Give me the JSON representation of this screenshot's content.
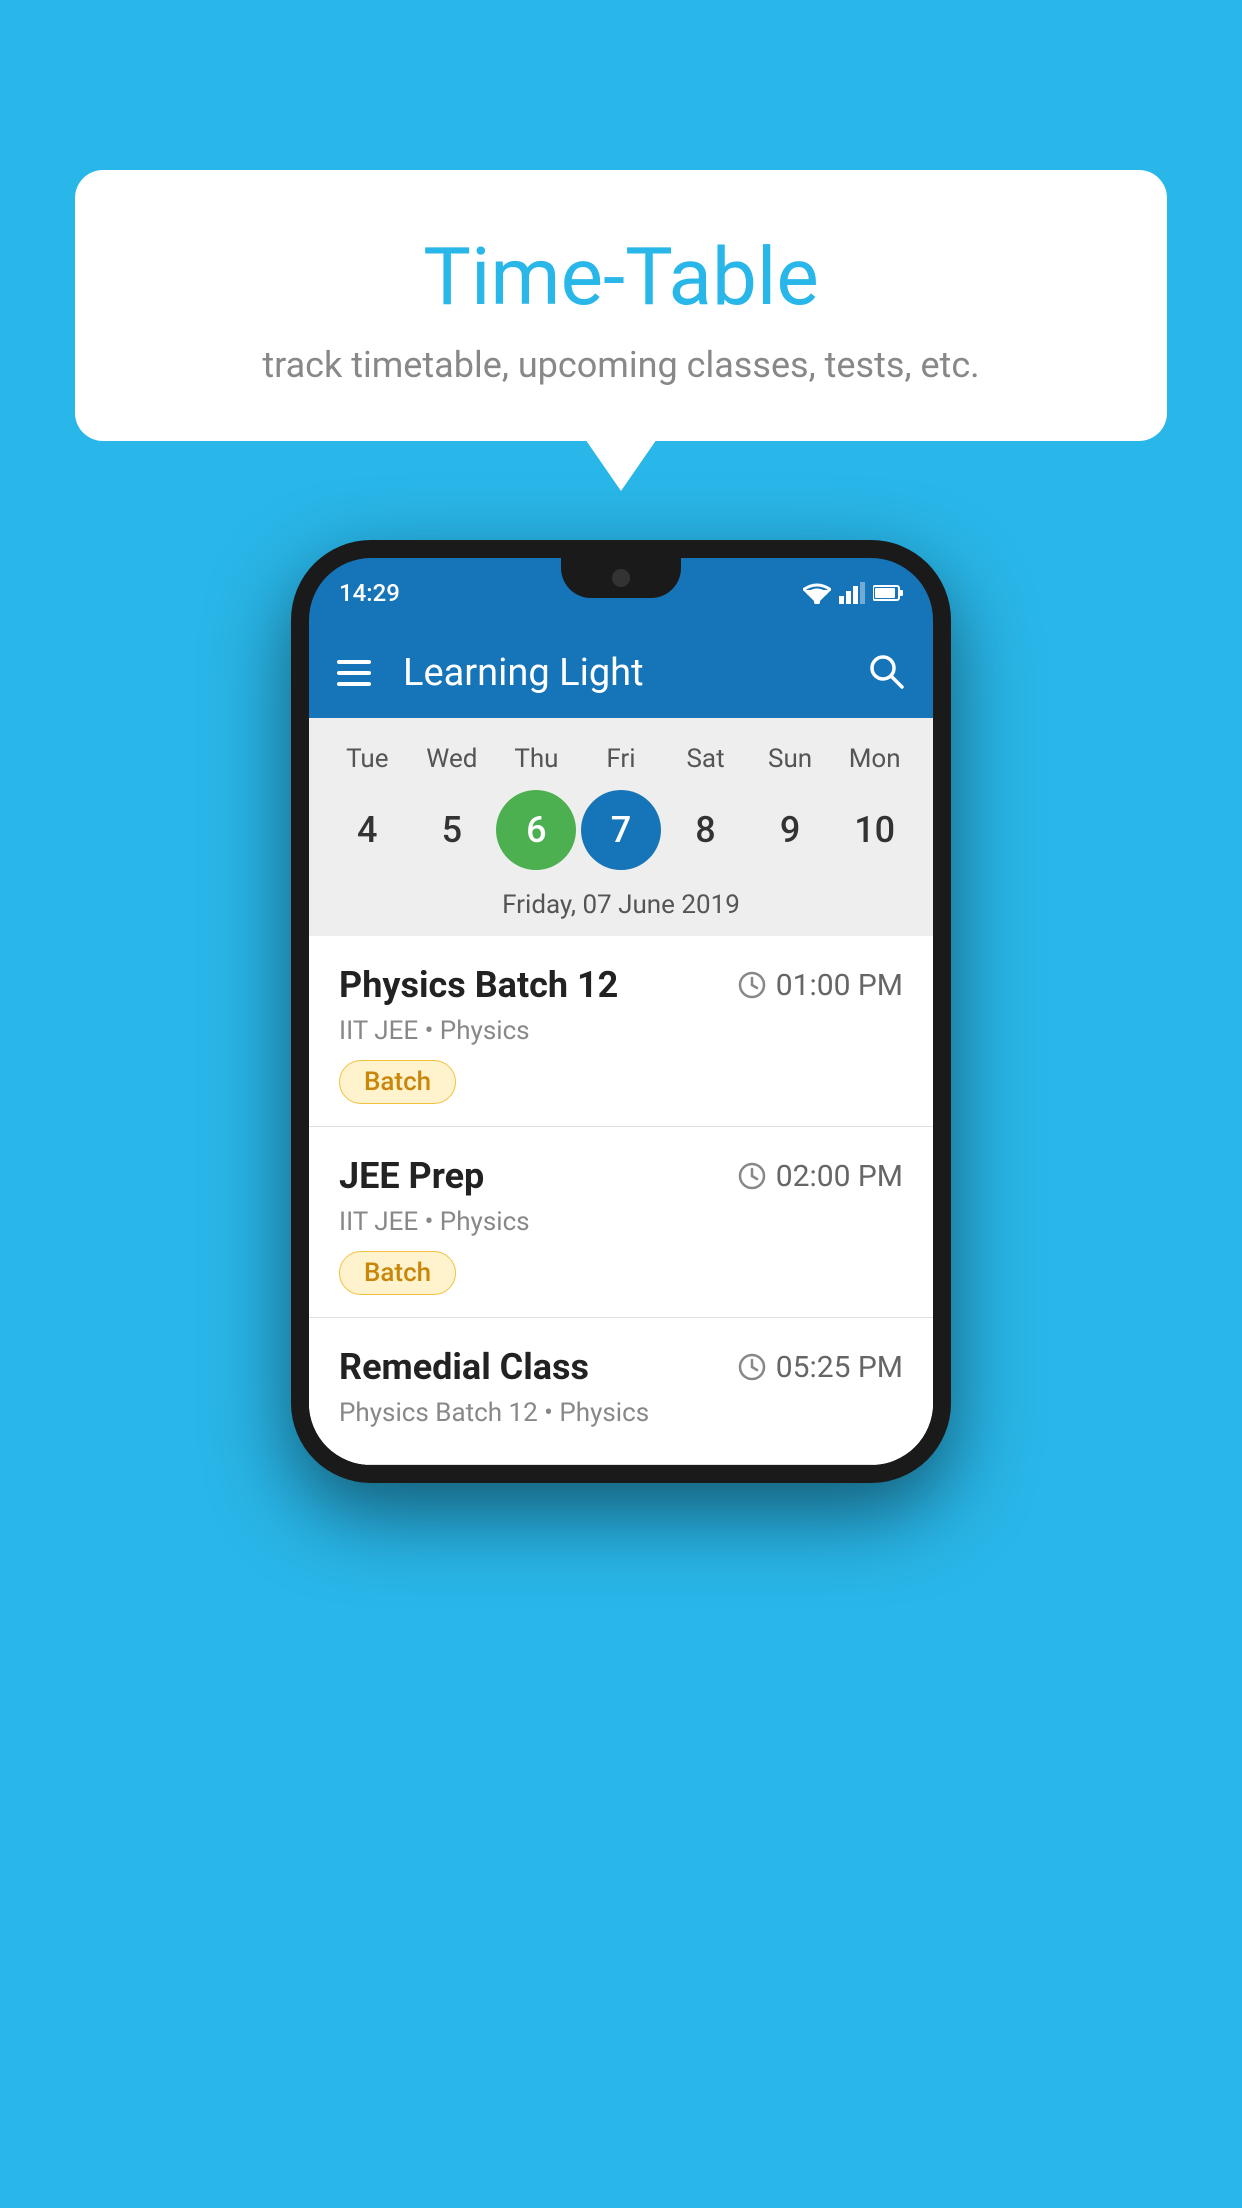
{
  "background_color": "#29b6e8",
  "tooltip": {
    "title": "Time-Table",
    "subtitle": "track timetable, upcoming classes, tests, etc."
  },
  "phone": {
    "status_bar": {
      "time": "14:29"
    },
    "app_bar": {
      "title": "Learning Light",
      "menu_icon": "hamburger-icon",
      "search_icon": "search-icon"
    },
    "calendar": {
      "days": [
        {
          "label": "Tue",
          "number": "4"
        },
        {
          "label": "Wed",
          "number": "5"
        },
        {
          "label": "Thu",
          "number": "6",
          "state": "today"
        },
        {
          "label": "Fri",
          "number": "7",
          "state": "selected"
        },
        {
          "label": "Sat",
          "number": "8"
        },
        {
          "label": "Sun",
          "number": "9"
        },
        {
          "label": "Mon",
          "number": "10"
        }
      ],
      "selected_date_label": "Friday, 07 June 2019"
    },
    "schedule": [
      {
        "name": "Physics Batch 12",
        "time": "01:00 PM",
        "category": "IIT JEE • Physics",
        "badge": "Batch"
      },
      {
        "name": "JEE Prep",
        "time": "02:00 PM",
        "category": "IIT JEE • Physics",
        "badge": "Batch"
      },
      {
        "name": "Remedial Class",
        "time": "05:25 PM",
        "category": "Physics Batch 12 • Physics",
        "badge": null
      }
    ]
  }
}
